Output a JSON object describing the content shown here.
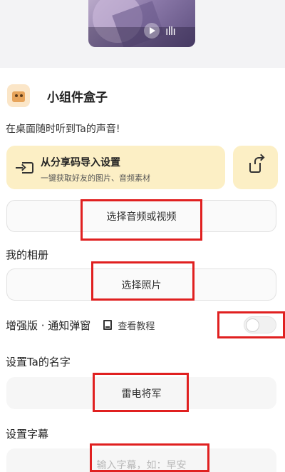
{
  "widget": {
    "title": "小组件盒子",
    "subtitle": "在桌面随时听到Ta的声音!"
  },
  "import_card": {
    "title": "从分享码导入设置",
    "subtitle": "一键获取好友的图片、音频素材"
  },
  "media": {
    "select_audio_video_label": "选择音频或视频"
  },
  "album": {
    "section_label": "我的相册",
    "select_photo_label": "选择照片"
  },
  "enhanced": {
    "label": "增强版 · 通知弹窗",
    "tutorial_link": "查看教程",
    "toggle_on": false
  },
  "name": {
    "section_label": "设置Ta的名字",
    "value": "雷电将军"
  },
  "subtitle_setting": {
    "section_label": "设置字幕",
    "placeholder": "输入字幕，如：早安"
  },
  "colors": {
    "card_bg": "#fcefc5",
    "highlight": "#e02020"
  }
}
